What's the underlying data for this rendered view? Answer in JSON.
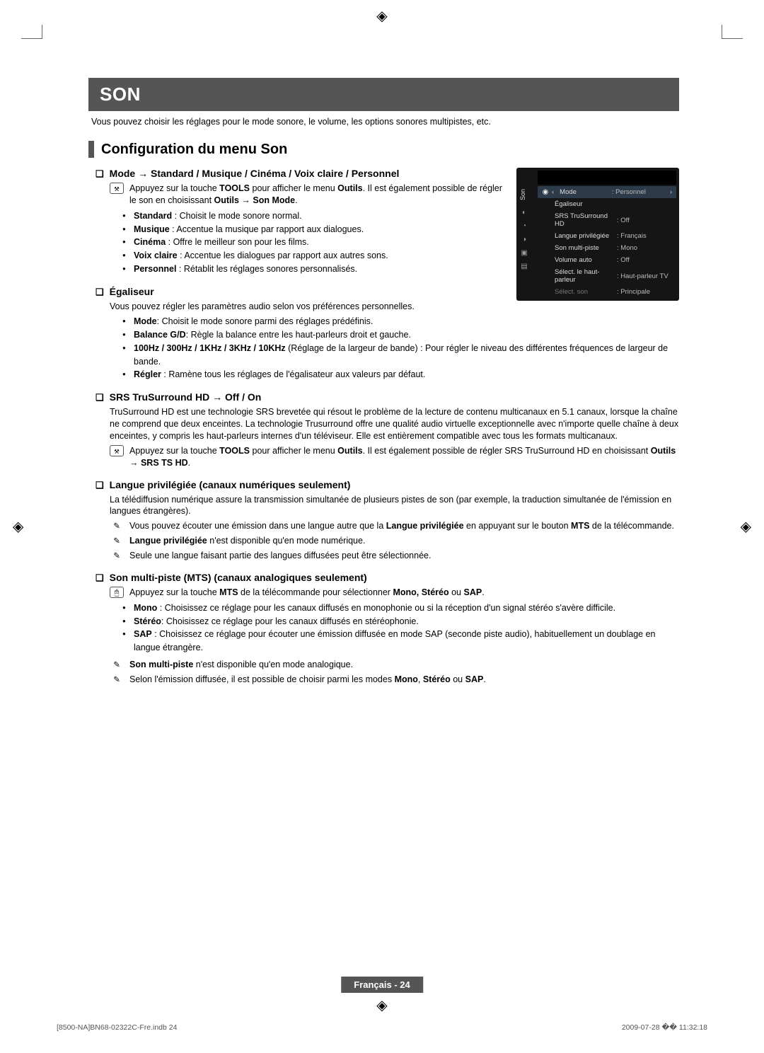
{
  "banner": "SON",
  "intro": "Vous pouvez choisir les réglages pour le mode sonore, le volume, les options sonores multipistes, etc.",
  "section_title": "Configuration du menu Son",
  "mode": {
    "head": "Mode → Standard / Musique / Cinéma / Voix claire / Personnel",
    "tool_pre": "Appuyez sur la touche ",
    "tool_b1": "TOOLS",
    "tool_mid1": " pour afficher le menu ",
    "tool_b2": "Outils",
    "tool_mid2": ". Il est également possible de régler le son en choisissant ",
    "tool_b3": "Outils → Son Mode",
    "tool_after": ".",
    "standard_b": "Standard",
    "standard_t": " : Choisit le mode sonore normal.",
    "musique_b": "Musique",
    "musique_t": " : Accentue la musique par rapport aux dialogues.",
    "cinema_b": "Cinéma",
    "cinema_t": " : Offre le meilleur son pour les films.",
    "voix_b": "Voix claire",
    "voix_t": " : Accentue les dialogues par rapport aux autres sons.",
    "perso_b": "Personnel",
    "perso_t": " : Rétablit les réglages sonores personnalisés."
  },
  "eq": {
    "head": "Égaliseur",
    "intro": "Vous pouvez régler les paramètres audio selon vos préférences personnelles.",
    "mode_b": "Mode",
    "mode_t": ": Choisit le mode sonore parmi des réglages prédéfinis.",
    "bal_b": "Balance G/D",
    "bal_t": ": Règle la balance entre les haut-parleurs droit et gauche.",
    "freq_b": "100Hz / 300Hz / 1KHz / 3KHz / 10KHz",
    "freq_t": " (Réglage de la largeur de bande) : Pour régler le niveau des différentes fréquences de largeur de bande.",
    "reg_b": "Régler",
    "reg_t": " : Ramène tous les réglages de l'égalisateur aux valeurs par défaut."
  },
  "srs": {
    "head": "SRS TruSurround HD → Off / On",
    "para": "TruSurround HD est une technologie SRS brevetée qui résout le problème de la lecture de contenu multicanaux en 5.1 canaux, lorsque la chaîne ne comprend que deux enceintes. La technologie Trusurround offre une qualité audio virtuelle exceptionnelle avec n'importe quelle chaîne à deux enceintes, y compris les haut-parleurs internes d'un téléviseur. Elle est entièrement compatible avec tous les formats multicanaux.",
    "tool_pre": "Appuyez sur la touche ",
    "tool_b1": "TOOLS",
    "tool_mid1": " pour afficher le menu ",
    "tool_b2": "Outils",
    "tool_mid2": ". Il est également possible de régler SRS TruSurround HD en choisissant ",
    "tool_b3": "Outils → SRS TS HD",
    "tool_after": "."
  },
  "lang": {
    "head": "Langue privilégiée (canaux numériques seulement)",
    "para": "La télédiffusion numérique assure la transmission simultanée de plusieurs pistes de son (par exemple, la traduction simultanée de l'émission en langues étrangères).",
    "n1_a": "Vous pouvez écouter une émission dans une langue autre que la ",
    "n1_b": "Langue privilégiée",
    "n1_c": " en appuyant sur le bouton ",
    "n1_d": "MTS",
    "n1_e": " de la télécommande.",
    "n2_b": "Langue privilégiée",
    "n2_t": " n'est disponible qu'en mode numérique.",
    "n3": "Seule une langue faisant partie des langues diffusées peut être sélectionnée."
  },
  "mts": {
    "head": "Son multi-piste (MTS) (canaux analogiques seulement)",
    "r1_a": "Appuyez sur la touche ",
    "r1_b": "MTS",
    "r1_c": " de la télécommande pour sélectionner ",
    "r1_d": "Mono, Stéréo",
    "r1_e": " ou ",
    "r1_f": "SAP",
    "r1_g": ".",
    "mono_b": "Mono",
    "mono_t": " : Choisissez ce réglage pour les canaux diffusés en monophonie ou si la réception d'un signal stéréo s'avère difficile.",
    "st_b": "Stéréo",
    "st_t": ": Choisissez ce réglage pour les canaux diffusés en stéréophonie.",
    "sap_b": "SAP",
    "sap_t": " : Choisissez ce réglage pour écouter une émission diffusée en mode SAP (seconde piste audio), habituellement un doublage en langue étrangère.",
    "n1_b": "Son multi-piste",
    "n1_t": " n'est disponible qu'en mode analogique.",
    "n2_a": "Selon l'émission diffusée, il est possible de choisir parmi les modes ",
    "n2_b": "Mono",
    "n2_c": ", ",
    "n2_d": "Stéréo",
    "n2_e": " ou ",
    "n2_f": "SAP",
    "n2_g": "."
  },
  "tvmenu": {
    "vlabel": "Son",
    "rows": [
      {
        "label": "Mode",
        "val": ": Personnel",
        "hl": true,
        "arrows": true
      },
      {
        "label": "Égaliseur",
        "val": ""
      },
      {
        "label": "SRS TruSurround HD",
        "val": ": Off"
      },
      {
        "label": "Langue privilégiée",
        "val": ": Français",
        "orange": true
      },
      {
        "label": "Son multi-piste",
        "val": ": Mono"
      },
      {
        "label": "Volume auto",
        "val": ": Off"
      },
      {
        "label": "Sélect. le haut-parleur",
        "val": ": Haut-parleur TV"
      },
      {
        "label": "Sélect. son",
        "val": ": Principale",
        "dim": true
      }
    ]
  },
  "footer_badge": "Français - 24",
  "print_left": "[8500-NA]BN68-02322C-Fre.indb   24",
  "print_right": "2009-07-28   �� 11:32:18"
}
